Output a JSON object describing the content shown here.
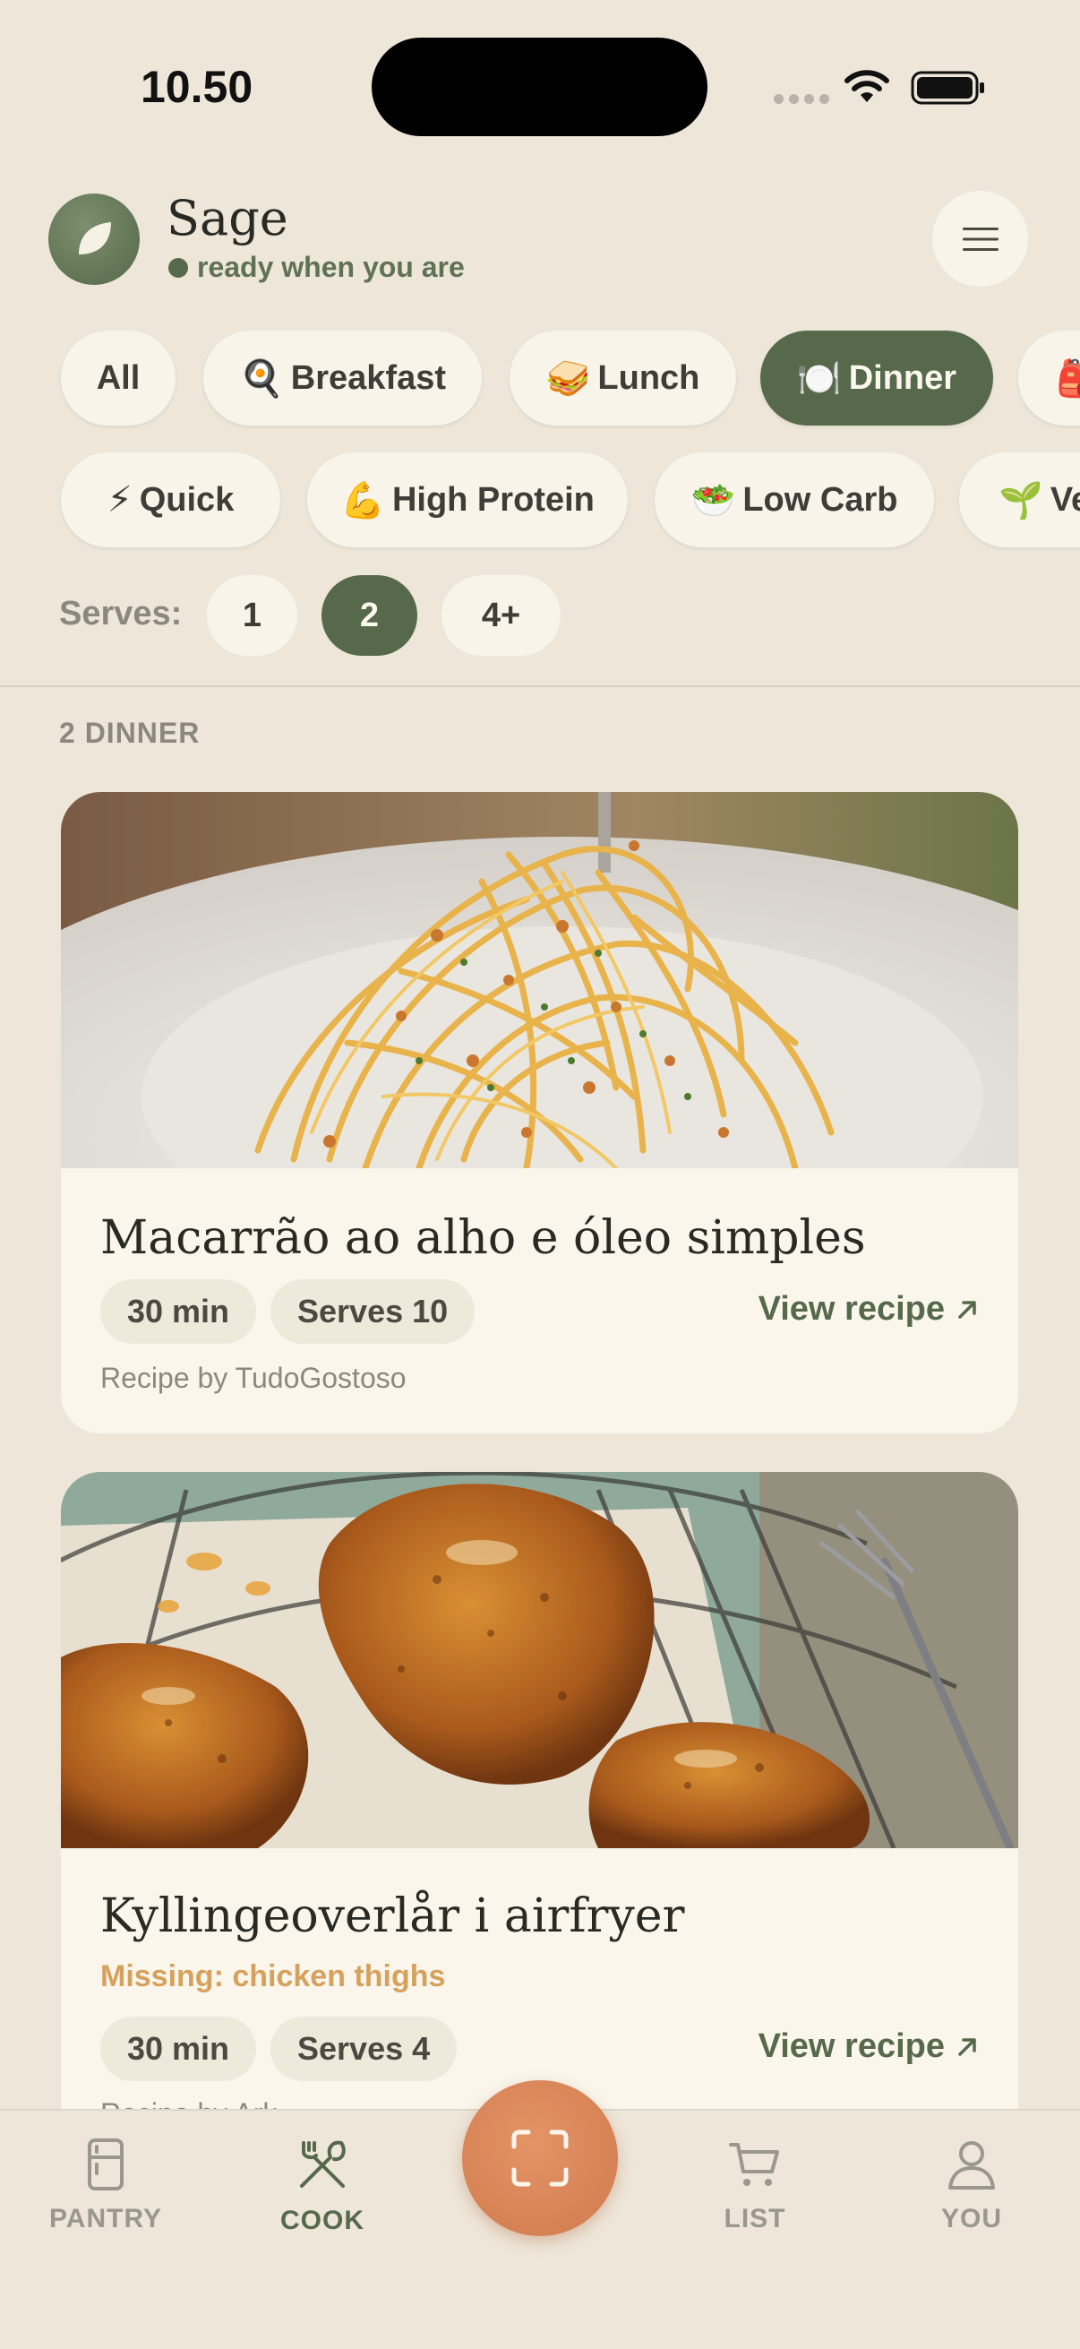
{
  "status_bar": {
    "time": "10.50"
  },
  "header": {
    "app_name": "Sage",
    "status_text": "ready when you are"
  },
  "meal_filters": [
    {
      "label": "All",
      "emoji": ""
    },
    {
      "label": "Breakfast",
      "emoji": "🍳"
    },
    {
      "label": "Lunch",
      "emoji": "🥪"
    },
    {
      "label": "Dinner",
      "emoji": "🍽️",
      "active": true
    },
    {
      "label": "",
      "emoji": "🎒"
    }
  ],
  "diet_filters": [
    {
      "label": "Quick",
      "emoji": "⚡"
    },
    {
      "label": "High Protein",
      "emoji": "💪"
    },
    {
      "label": "Low Carb",
      "emoji": "🥗"
    },
    {
      "label": "Ve",
      "emoji": "🌱"
    }
  ],
  "serves": {
    "label": "Serves:",
    "options": [
      "1",
      "2",
      "4+"
    ],
    "selected": "2"
  },
  "results_label": "2 DINNER",
  "recipes": [
    {
      "title": "Macarrão ao alho e óleo simples",
      "time": "30 min",
      "serves": "Serves 10",
      "view_label": "View recipe",
      "credit": "Recipe by TudoGostoso",
      "missing": ""
    },
    {
      "title": "Kyllingeoverlår i airfryer",
      "time": "30 min",
      "serves": "Serves 4",
      "view_label": "View recipe",
      "credit": "Recipe by Ark",
      "missing": "Missing: chicken thighs"
    }
  ],
  "bottom_nav": {
    "pantry": "PANTRY",
    "cook": "COOK",
    "list": "LIST",
    "you": "YOU"
  },
  "colors": {
    "background": "#ede6d9",
    "accent_green": "#56694b",
    "card": "#faf6ec",
    "scan_orange": "#d9865a",
    "missing_text": "#d6a15c"
  },
  "icons": [
    "leaf-icon",
    "menu-icon",
    "arrow-up-right-icon",
    "fridge-icon",
    "fork-knife-icon",
    "scan-icon",
    "cart-icon",
    "person-icon"
  ]
}
